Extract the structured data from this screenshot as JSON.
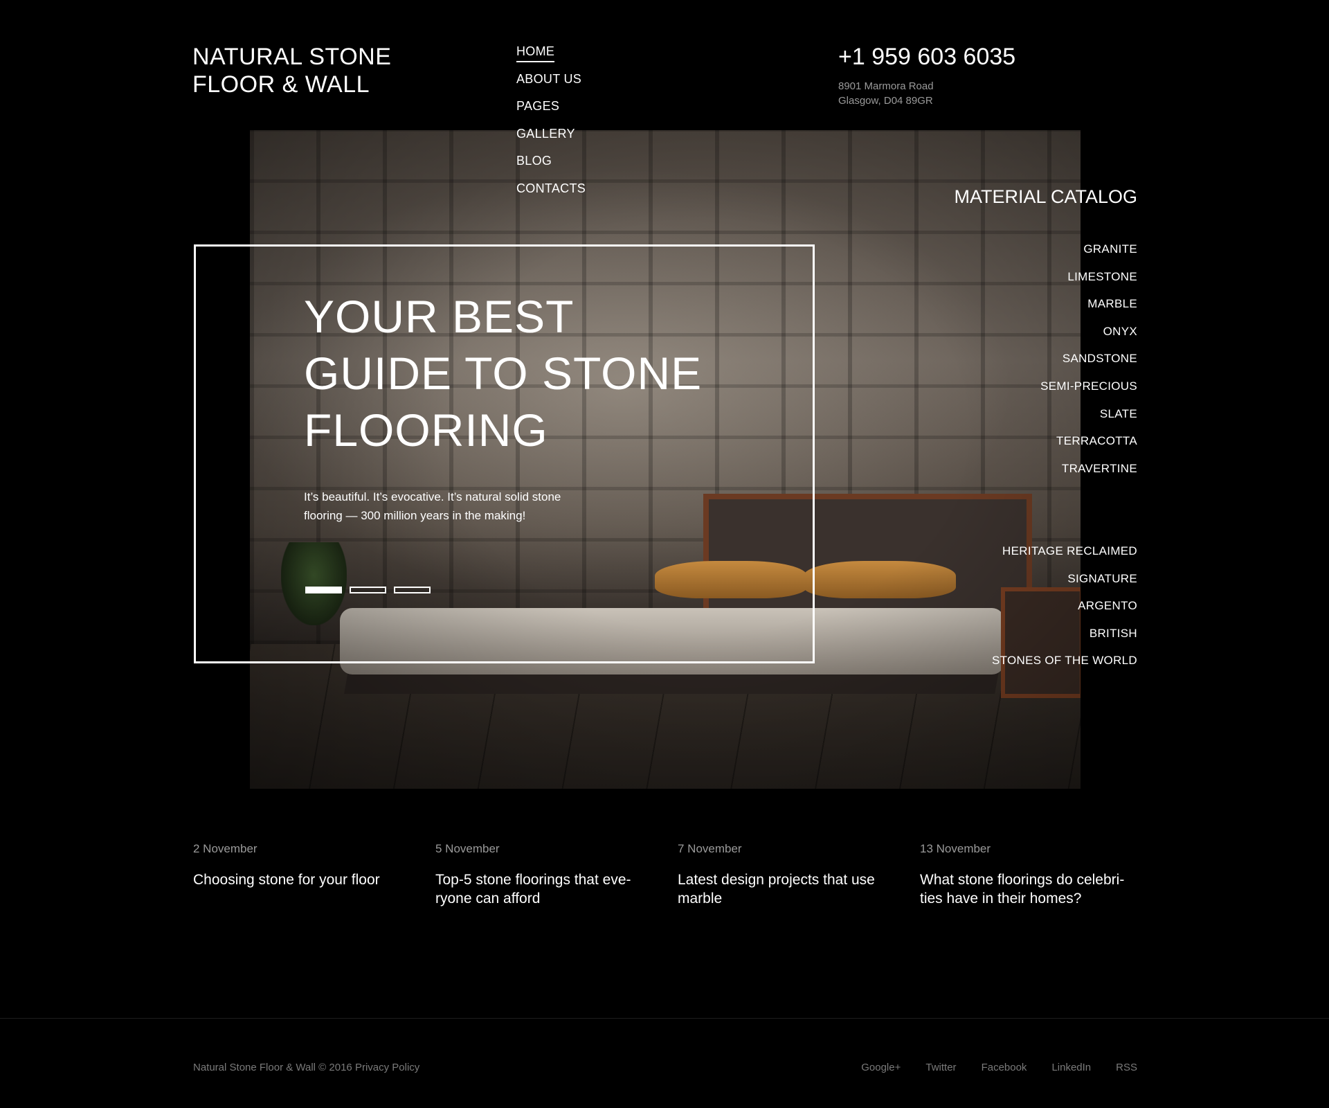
{
  "brand": {
    "logo_line1": "NATURAL STONE",
    "logo_line2": "FLOOR & WALL"
  },
  "nav": {
    "items": [
      {
        "label": "HOME",
        "active": true
      },
      {
        "label": "ABOUT US"
      },
      {
        "label": "PAGES"
      },
      {
        "label": "GALLERY"
      },
      {
        "label": "BLOG"
      },
      {
        "label": "CONTACTS"
      }
    ]
  },
  "contact": {
    "phone": "+1 959 603 6035",
    "address_line1": "8901 Marmora Road",
    "address_line2": "Glasgow, D04 89GR"
  },
  "hero": {
    "title_line1": "YOUR BEST",
    "title_line2": "GUIDE TO STONE",
    "title_line3": "FLOORING",
    "text_line1": "It’s beautiful. It’s evocative. It’s natural solid stone",
    "text_line2": "flooring — 300 million years in the making!",
    "slides": {
      "count": 3,
      "active_index": 0
    }
  },
  "catalog": {
    "title": "MATERIAL CATALOG",
    "materials": [
      "GRANITE",
      "LIMESTONE",
      "MARBLE",
      "ONYX",
      "SANDSTONE",
      "SEMI-PRECIOUS",
      "SLATE",
      "TERRACOTTA",
      "TRAVERTINE"
    ],
    "collections": [
      "HERITAGE RECLAIMED",
      "SIGNATURE",
      "ARGENTO",
      "BRITISH",
      "STONES OF THE WORLD"
    ]
  },
  "posts": [
    {
      "date": "2 November",
      "title": "Choosing stone for your floor"
    },
    {
      "date": "5 November",
      "title": "Top-5 stone floorings that eve­ryone can afford"
    },
    {
      "date": "7 November",
      "title": "Latest design projects that use marble"
    },
    {
      "date": "13 November",
      "title": "What stone floorings do celebri­ties have in their homes?"
    }
  ],
  "footer": {
    "copyright": "Natural Stone Floor & Wall © 2016",
    "privacy": "Privacy Policy",
    "social": [
      "Google+",
      "Twitter",
      "Facebook",
      "LinkedIn",
      "RSS"
    ]
  },
  "colors": {
    "background": "#000000",
    "text": "#ffffff",
    "muted": "#9a9a9a"
  }
}
